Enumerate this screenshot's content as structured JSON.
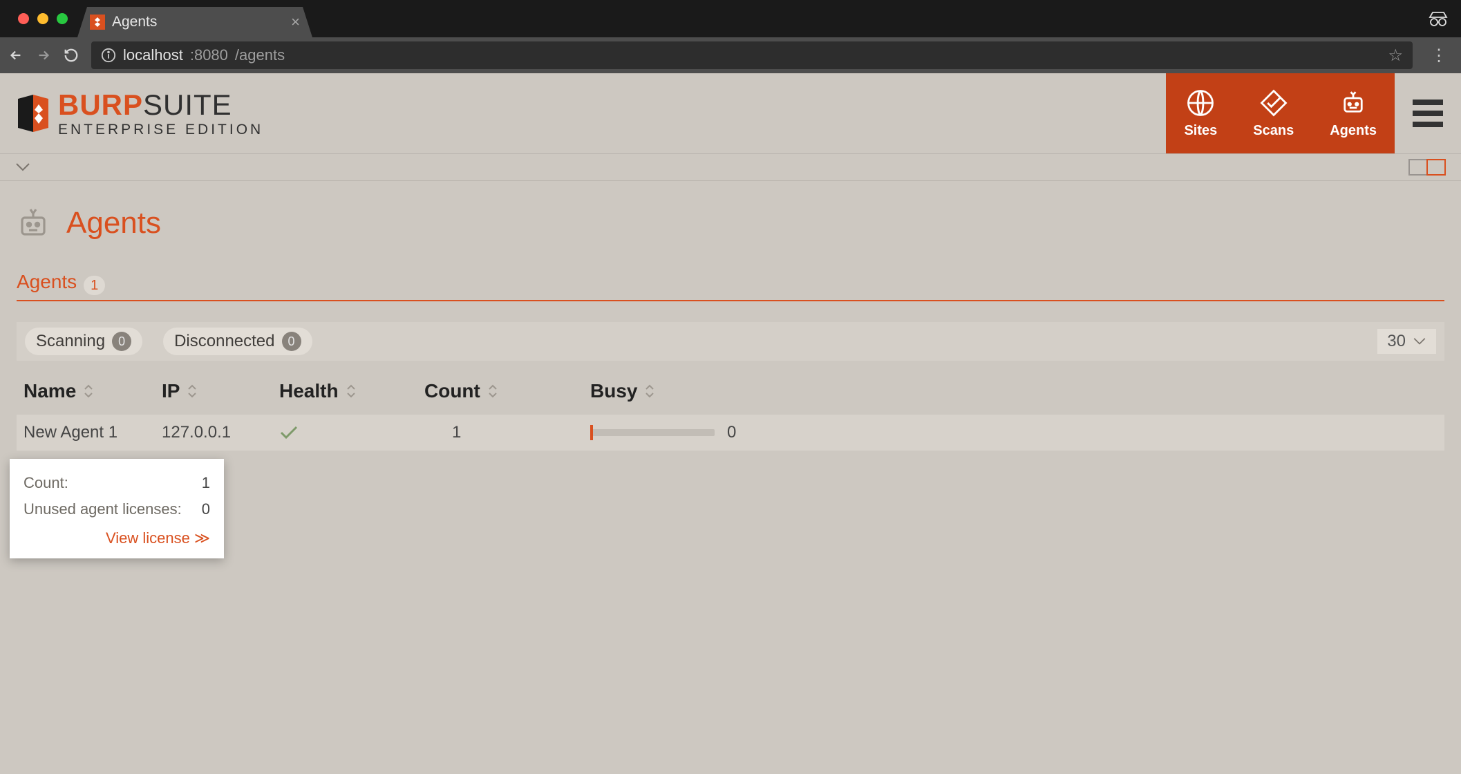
{
  "browser": {
    "tab_title": "Agents",
    "url": {
      "host": "localhost",
      "port": ":8080",
      "path": "/agents"
    }
  },
  "brand": {
    "burp": "BURP",
    "suite": "SUITE",
    "sub": "ENTERPRISE EDITION"
  },
  "nav": {
    "sites": "Sites",
    "scans": "Scans",
    "agents": "Agents"
  },
  "page": {
    "title": "Agents"
  },
  "section": {
    "tab_label": "Agents",
    "count": "1"
  },
  "filters": {
    "scanning": {
      "label": "Scanning",
      "count": "0"
    },
    "disconnected": {
      "label": "Disconnected",
      "count": "0"
    },
    "page_size": "30"
  },
  "table": {
    "headers": {
      "name": "Name",
      "ip": "IP",
      "health": "Health",
      "count": "Count",
      "busy": "Busy"
    },
    "rows": [
      {
        "name": "New Agent 1",
        "ip": "127.0.0.1",
        "count": "1",
        "busy": "0"
      }
    ]
  },
  "popover": {
    "count_label": "Count:",
    "count_value": "1",
    "unused_label": "Unused agent licenses:",
    "unused_value": "0",
    "link": "View license"
  }
}
